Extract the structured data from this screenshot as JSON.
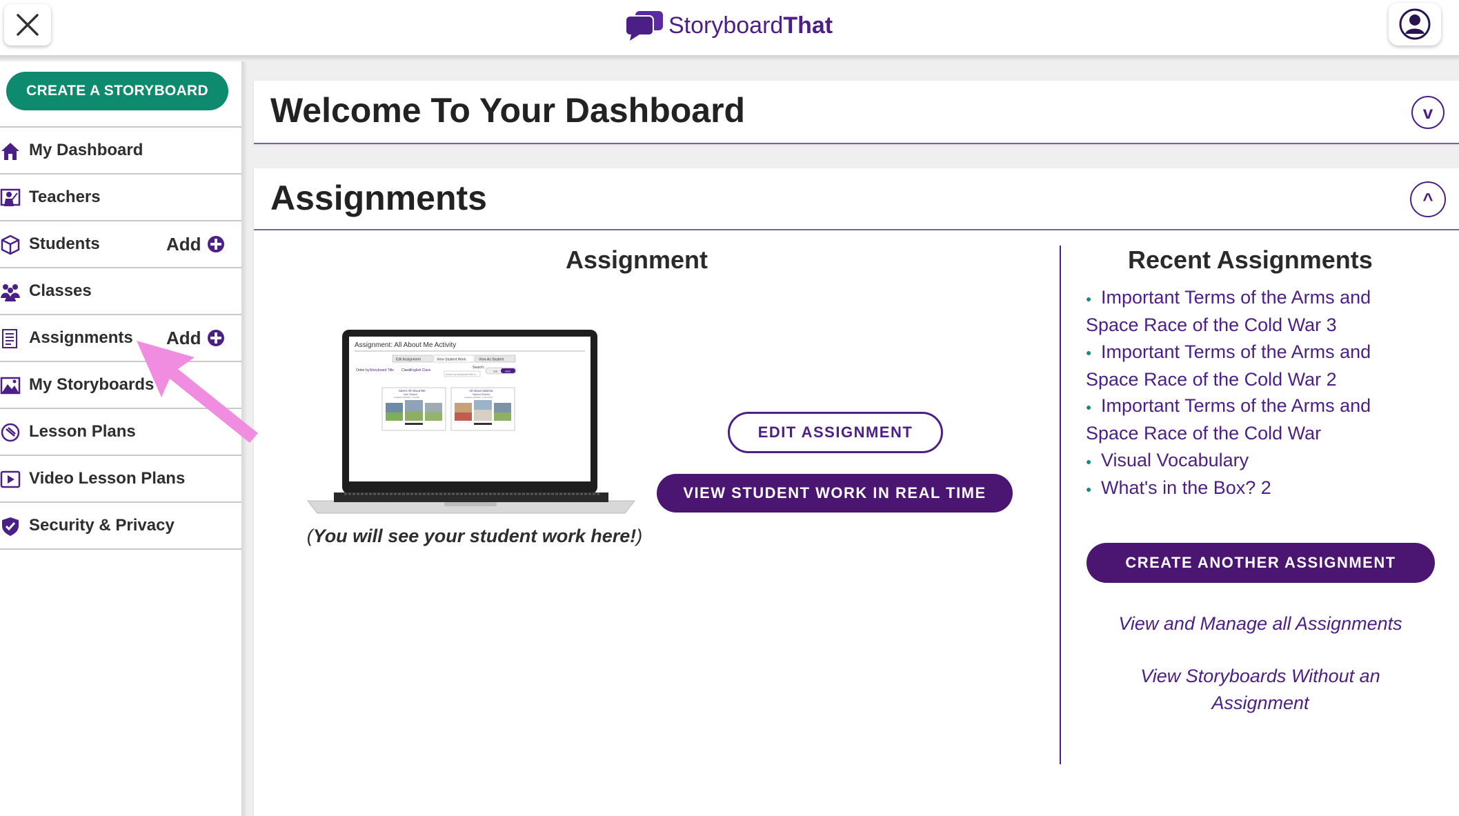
{
  "topbar": {
    "logo_regular": "Storyboard",
    "logo_bold": "That"
  },
  "sidebar": {
    "create_label": "CREATE A STORYBOARD",
    "items": [
      {
        "label": "My Dashboard",
        "icon": "home-icon"
      },
      {
        "label": "Teachers",
        "icon": "teacher-icon"
      },
      {
        "label": "Students",
        "icon": "students-icon",
        "add": "Add"
      },
      {
        "label": "Classes",
        "icon": "classes-icon"
      },
      {
        "label": "Assignments",
        "icon": "assignments-icon",
        "add": "Add"
      },
      {
        "label": "My Storyboards",
        "icon": "storyboards-icon"
      },
      {
        "label": "Lesson Plans",
        "icon": "lesson-plans-icon"
      },
      {
        "label": "Video Lesson Plans",
        "icon": "video-icon"
      },
      {
        "label": "Security & Privacy",
        "icon": "shield-icon"
      }
    ]
  },
  "welcome": {
    "title": "Welcome To Your Dashboard",
    "toggle": "v"
  },
  "assignments": {
    "title": "Assignments",
    "toggle": "^",
    "left": {
      "heading": "Assignment",
      "caption_open": "(",
      "caption": "You will see your student work here!",
      "caption_close": ")",
      "edit_label": "EDIT ASSIGNMENT",
      "view_label": "VIEW STUDENT WORK IN REAL TIME",
      "preview": {
        "title": "Assignment: All About Me Activity",
        "tabs": [
          "Edit Assignment",
          "View Student Work",
          "View As Student"
        ],
        "order_by": "Order by:",
        "order_value": "Storyboard Title",
        "class_label": "Class:",
        "class_value": "English Class",
        "search_label": "Search:",
        "search_placeholder": "Search by storyboard title or...",
        "list_label": "List",
        "grid_label": "Grid",
        "cards": [
          {
            "title": "Sam's All About Me",
            "author": "Sam Student",
            "updated": "Updated 1/3/2022, 1:42 PM"
          },
          {
            "title": "All About Sabrina",
            "author": "Sabrina Student",
            "updated": "Updated 1/3/2022, 1:42:13 PM"
          }
        ]
      }
    },
    "right": {
      "heading": "Recent Assignments",
      "recent": [
        "Important Terms of the Arms and Space Race of the Cold War 3",
        "Important Terms of the Arms and Space Race of the Cold War 2",
        "Important Terms of the Arms and Space Race of the Cold War",
        "Visual Vocabulary",
        "What's in the Box? 2"
      ],
      "create_label": "CREATE ANOTHER ASSIGNMENT",
      "manage_link": "View and Manage all Assignments",
      "without_link": "View Storyboards Without an Assignment"
    }
  },
  "colors": {
    "brand_purple": "#4b1f86",
    "button_purple": "#4b1572",
    "create_green": "#0e8a6e",
    "annotation_pink": "#f08de0"
  }
}
